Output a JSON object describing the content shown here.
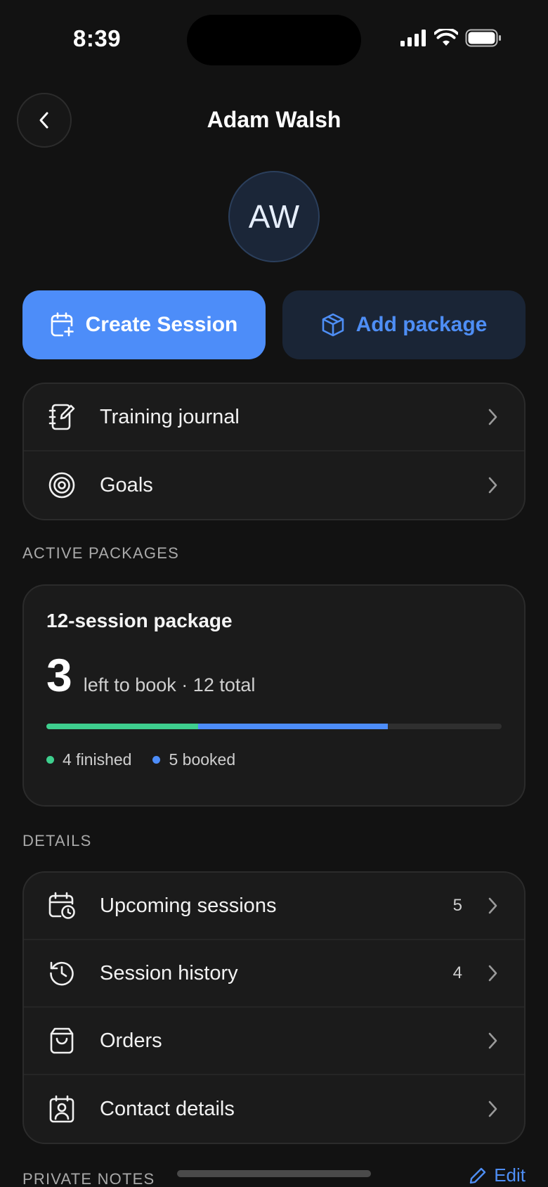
{
  "status": {
    "time": "8:39"
  },
  "header": {
    "title": "Adam Walsh",
    "back_icon": "chevron-left-icon"
  },
  "avatar": {
    "initials": "AW"
  },
  "actions": {
    "create_session": "Create Session",
    "add_package": "Add package"
  },
  "quick_links": [
    {
      "label": "Training journal",
      "icon": "journal-icon"
    },
    {
      "label": "Goals",
      "icon": "target-icon"
    }
  ],
  "active_packages": {
    "section_label": "ACTIVE PACKAGES",
    "package": {
      "title": "12-session package",
      "left_to_book": "3",
      "subtitle": "left to book · 12 total",
      "total": 12,
      "finished": 4,
      "booked": 5,
      "finished_label": "4 finished",
      "booked_label": "5 booked",
      "colors": {
        "finished": "#3ecf8e",
        "booked": "#4d8df9",
        "track": "#2f2f2f"
      }
    }
  },
  "details": {
    "section_label": "DETAILS",
    "items": [
      {
        "label": "Upcoming sessions",
        "count": "5",
        "icon": "calendar-clock-icon"
      },
      {
        "label": "Session history",
        "count": "4",
        "icon": "history-icon"
      },
      {
        "label": "Orders",
        "count": "",
        "icon": "shopping-bag-icon"
      },
      {
        "label": "Contact details",
        "count": "",
        "icon": "contact-card-icon"
      }
    ]
  },
  "private_notes": {
    "section_label": "PRIVATE NOTES",
    "edit_label": "Edit"
  },
  "colors": {
    "accent": "#4d8df9",
    "background": "#121212",
    "card": "#1b1b1b"
  }
}
